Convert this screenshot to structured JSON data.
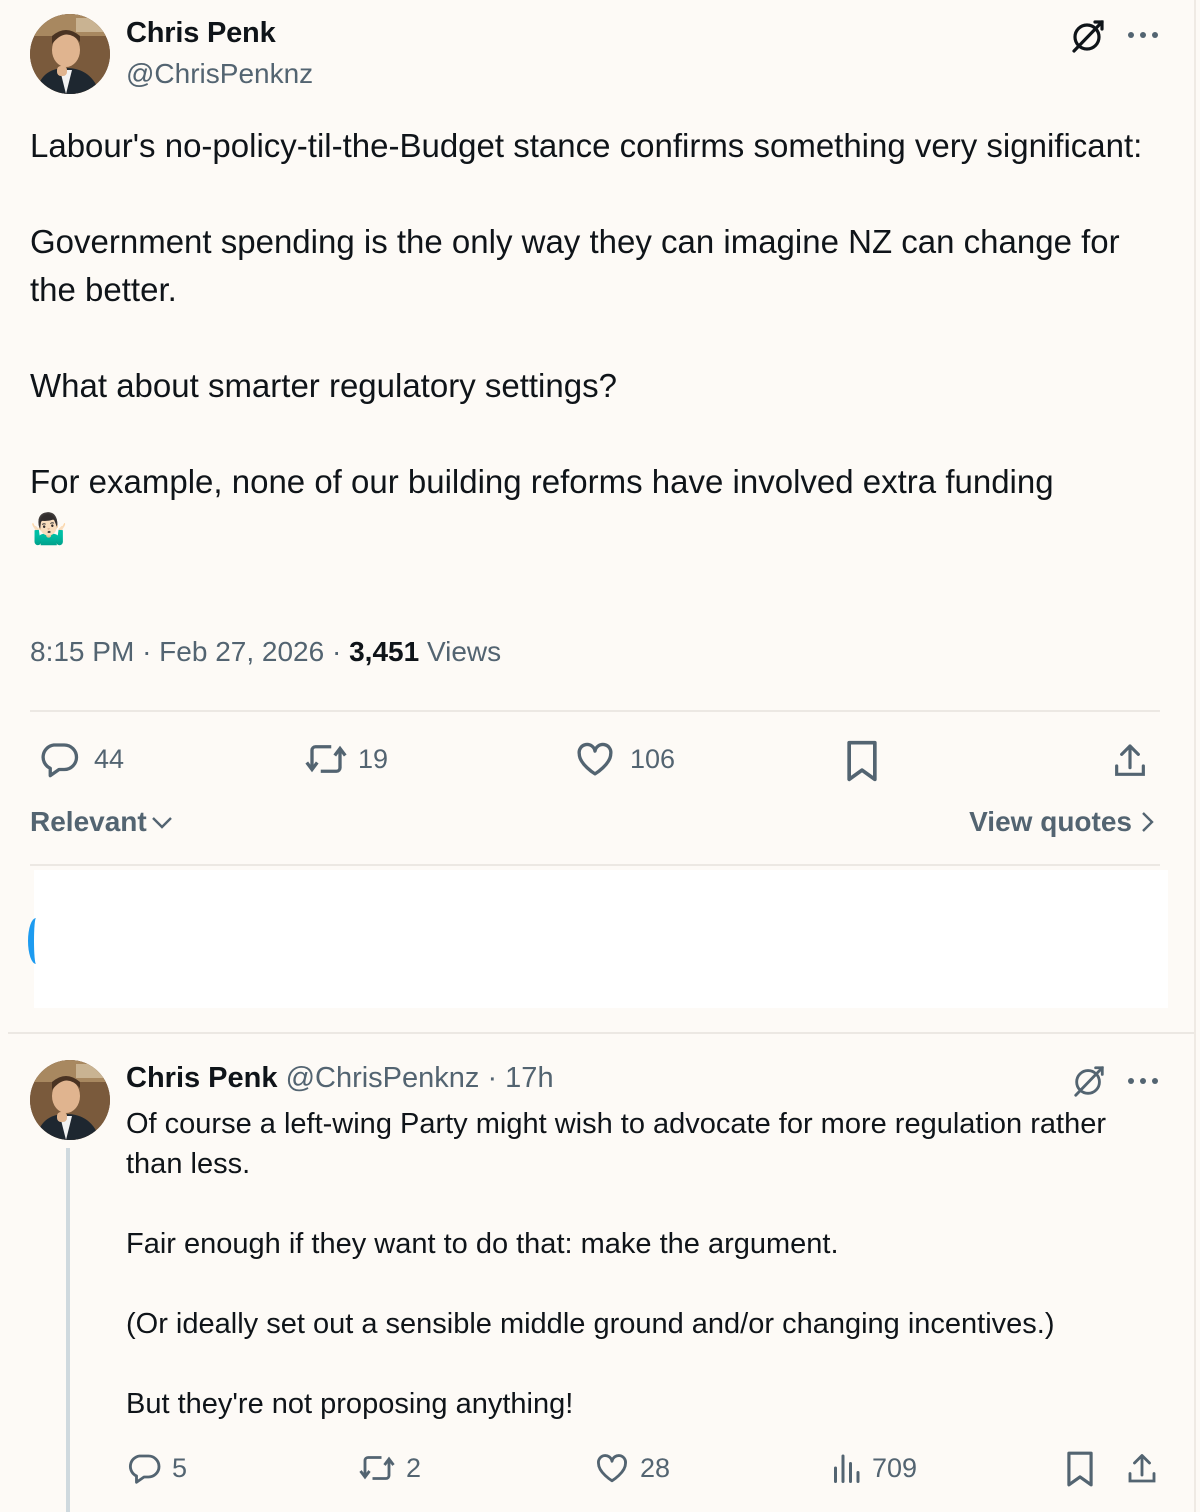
{
  "tweet": {
    "author_name": "Chris Penk",
    "author_handle": "@ChrisPenknz",
    "paragraphs": [
      "Labour's no-policy-til-the-Budget stance confirms something very significant:",
      "Government spending is the only way they can imagine NZ can change for the better.",
      "What about smarter regulatory settings?",
      "For example, none of our building reforms have involved extra funding"
    ],
    "emoji": "🤷🏻‍♂️",
    "time": "8:15 PM",
    "date": "Feb 27, 2026",
    "separator": "·",
    "views_count": "3,451",
    "views_label": "Views",
    "replies": "44",
    "reposts": "19",
    "likes": "106",
    "icons": [
      "grok-icon",
      "more-icon",
      "reply-icon",
      "repost-icon",
      "like-icon",
      "bookmark-icon",
      "share-icon"
    ]
  },
  "filters": {
    "sort_label": "Relevant",
    "view_quotes_label": "View quotes"
  },
  "reply": {
    "author_name": "Chris Penk",
    "author_handle": "@ChrisPenknz",
    "age": "· 17h",
    "paragraphs": [
      "Of course a left-wing Party might wish to advocate for more regulation rather than less.",
      "Fair enough if they want to do that: make the argument.",
      "(Or ideally set out a sensible middle ground and/or changing incentives.)",
      "But they're not proposing anything!"
    ],
    "replies": "5",
    "reposts": "2",
    "likes": "28",
    "views": "709",
    "icons": [
      "grok-icon",
      "more-icon",
      "reply-icon",
      "repost-icon",
      "like-icon",
      "analytics-icon",
      "bookmark-icon",
      "share-icon"
    ]
  },
  "colors": {
    "background": "#fdfaf6",
    "text_primary": "#0f1419",
    "text_secondary": "#536471",
    "divider": "#ece8e3",
    "thread_line": "#cfd9de",
    "accent_blue": "#1d9bf0"
  }
}
